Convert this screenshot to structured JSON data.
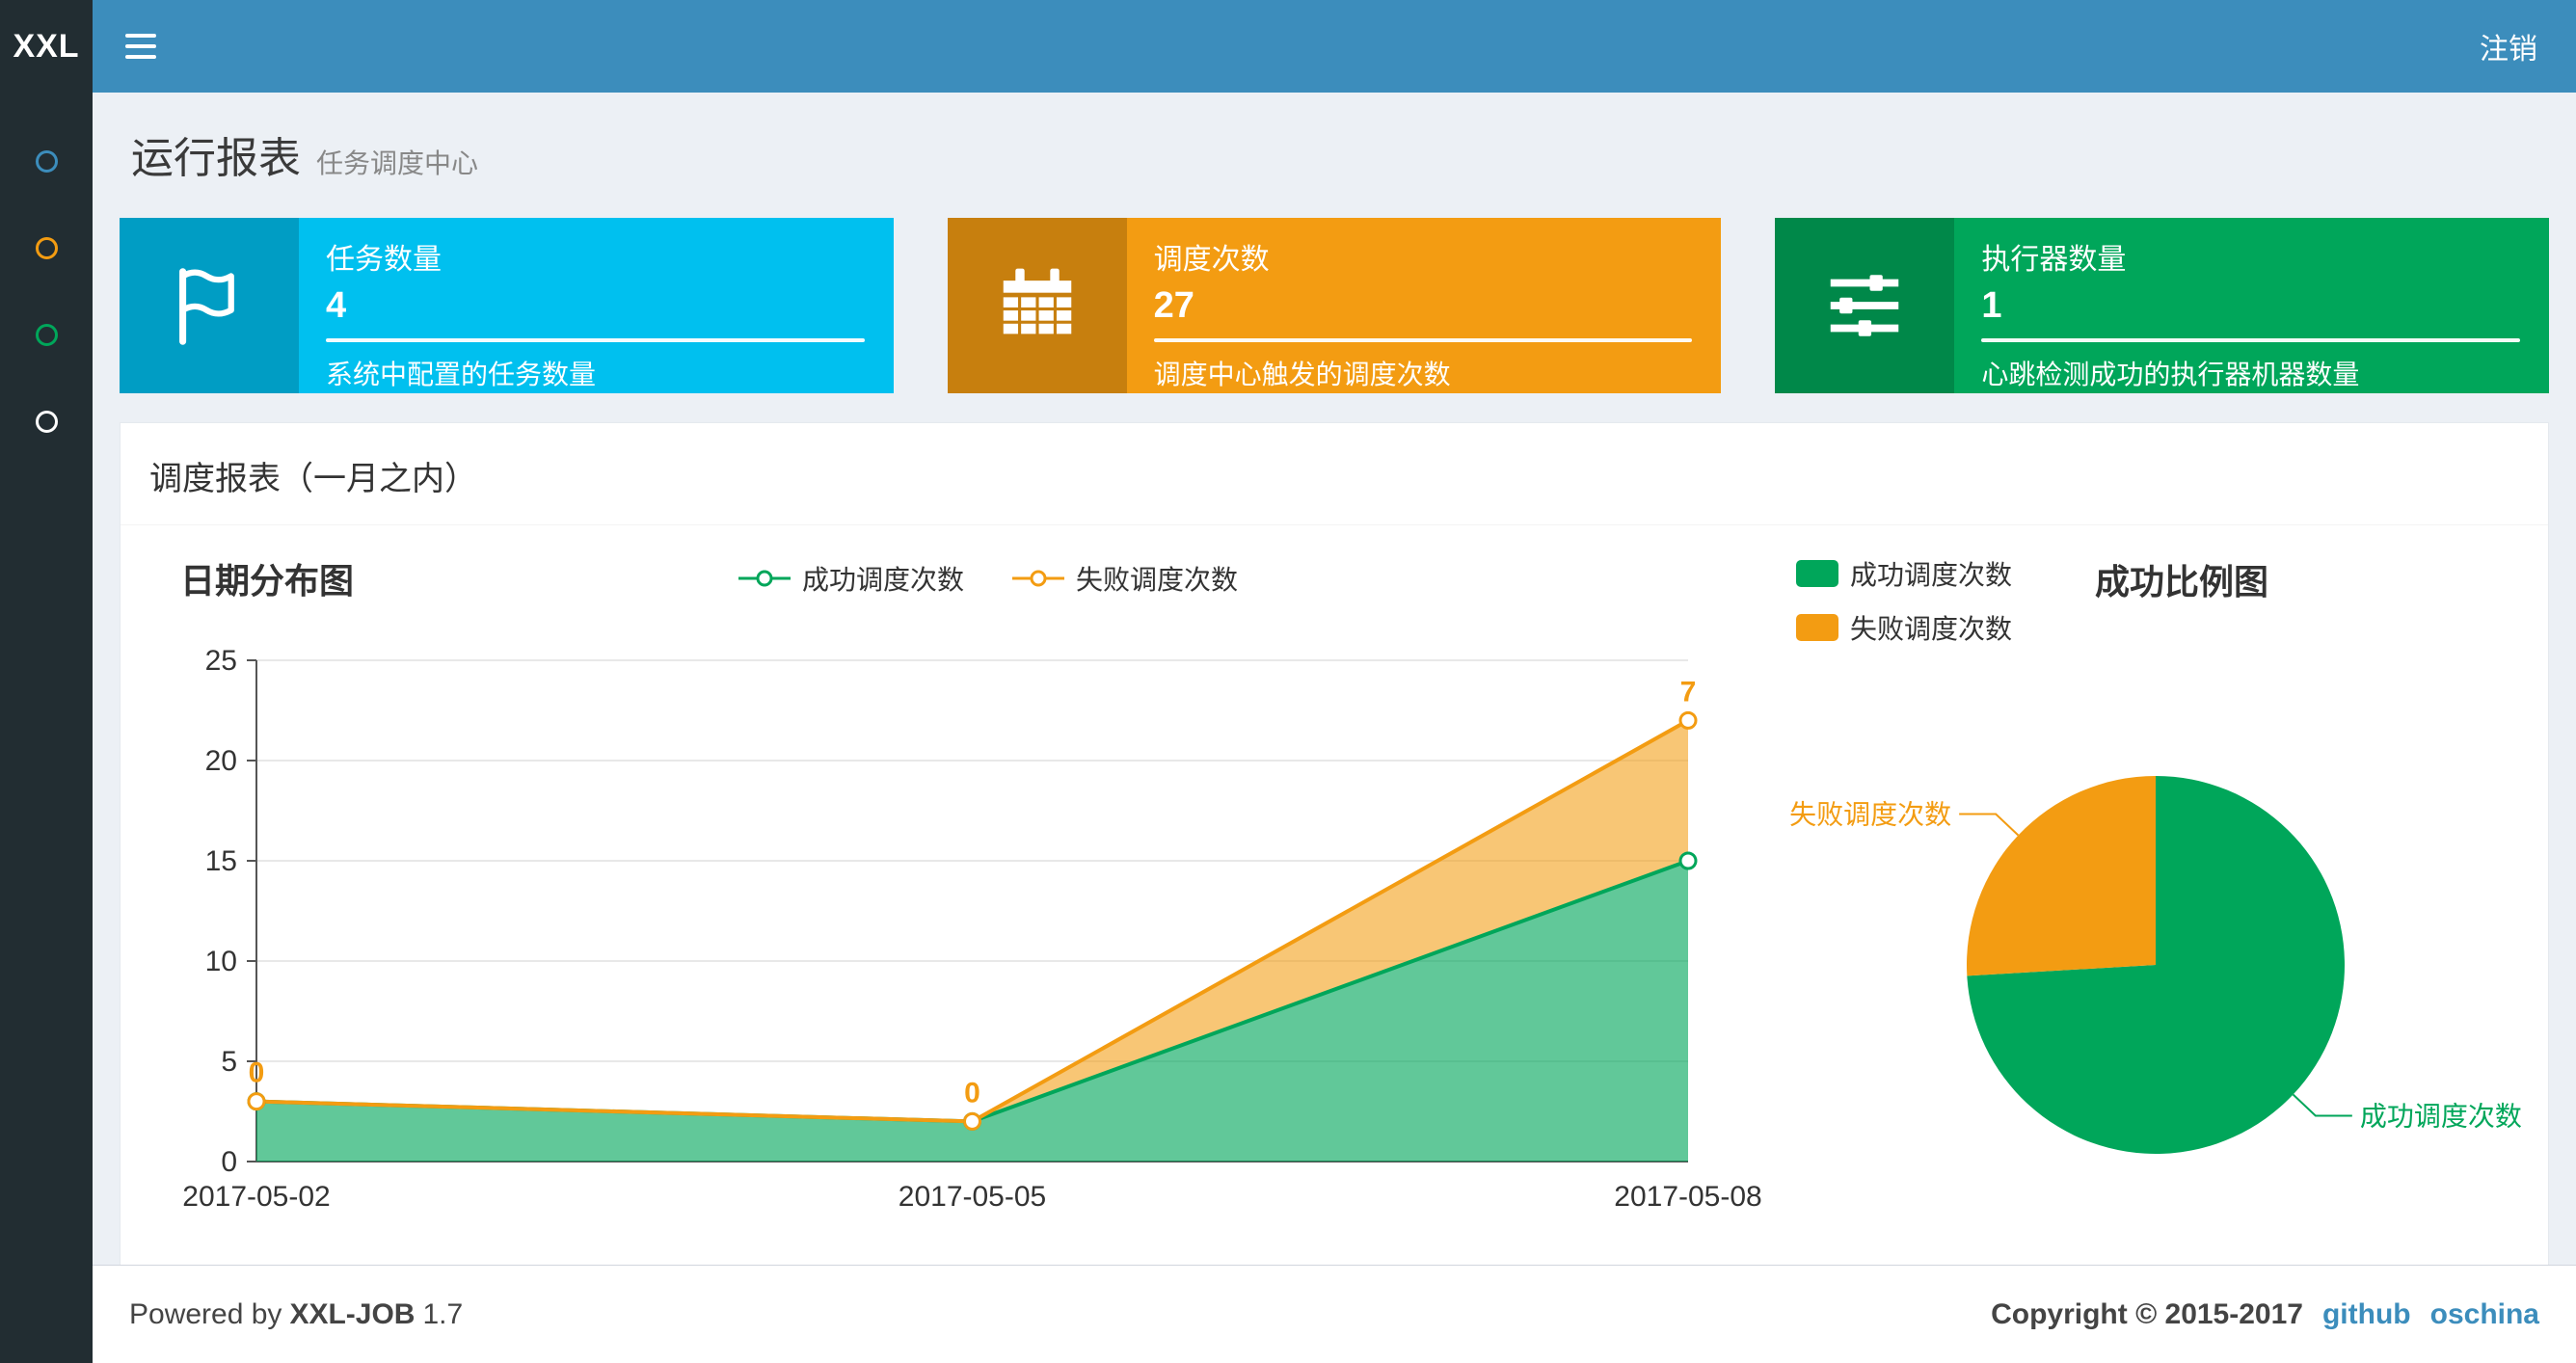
{
  "colors": {
    "navbar": "#3c8dbc",
    "sidebar": "#222d32",
    "content_bg": "#ecf0f5",
    "info": "#00c0ef",
    "warning": "#f39c12",
    "success": "#00a65a",
    "link": "#3c8dbc"
  },
  "navbar": {
    "logo": "XXL",
    "logout_label": "注销"
  },
  "sidebar": {
    "items": [
      {
        "icon": "circle-icon",
        "color": "#3c8dbc"
      },
      {
        "icon": "circle-icon",
        "color": "#f39c12"
      },
      {
        "icon": "circle-icon",
        "color": "#00a65a"
      },
      {
        "icon": "circle-icon",
        "color": "#ffffff"
      }
    ]
  },
  "page": {
    "title": "运行报表",
    "subtitle": "任务调度中心"
  },
  "stat_boxes": [
    {
      "title": "任务数量",
      "value": "4",
      "desc": "系统中配置的任务数量",
      "color": "#00c0ef",
      "icon": "flag-icon"
    },
    {
      "title": "调度次数",
      "value": "27",
      "desc": "调度中心触发的调度次数",
      "color": "#f39c12",
      "icon": "calendar-icon"
    },
    {
      "title": "执行器数量",
      "value": "1",
      "desc": "心跳检测成功的执行器机器数量",
      "color": "#00a65a",
      "icon": "sliders-icon"
    }
  ],
  "panel": {
    "title": "调度报表（一月之内）"
  },
  "chart_data": [
    {
      "type": "area",
      "title": "日期分布图",
      "stacked": true,
      "x": [
        "2017-05-02",
        "2017-05-05",
        "2017-05-08"
      ],
      "series": [
        {
          "name": "成功调度次数",
          "color": "#00a65a",
          "values": [
            3,
            2,
            15
          ]
        },
        {
          "name": "失败调度次数",
          "color": "#f39c12",
          "values": [
            0,
            0,
            7
          ],
          "labels": [
            "0",
            "0",
            "7"
          ]
        }
      ],
      "ylim": [
        0,
        25
      ],
      "yticks": [
        0,
        5,
        10,
        15,
        20,
        25
      ],
      "grid": true,
      "legend_position": "top-center"
    },
    {
      "type": "pie",
      "title": "成功比例图",
      "slices": [
        {
          "name": "成功调度次数",
          "value": 20,
          "color": "#00a65a"
        },
        {
          "name": "失败调度次数",
          "value": 7,
          "color": "#f39c12"
        }
      ],
      "start_angle": 90,
      "legend_position": "top-left"
    }
  ],
  "footer": {
    "powered_prefix": "Powered by",
    "product": "XXL-JOB",
    "version": "1.7",
    "copyright": "Copyright © 2015-2017",
    "links": [
      {
        "label": "github"
      },
      {
        "label": "oschina"
      }
    ]
  }
}
